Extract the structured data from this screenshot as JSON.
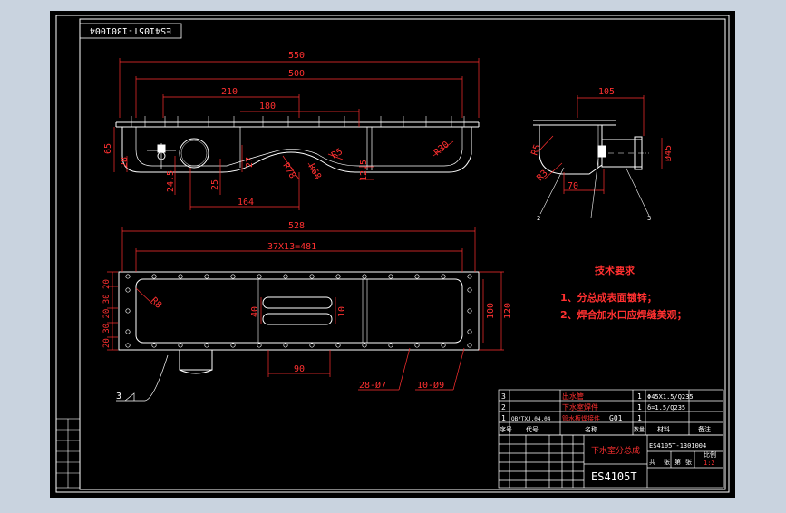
{
  "colors": {
    "viewer_bg": "#c9d3df",
    "sheet_bg": "#000000",
    "line": "#ffffff",
    "dim": "#ff3030",
    "title_text": "#ff3030",
    "table_line": "#ffffff",
    "hatch": "#ff3030"
  },
  "drawing_no_stamp": "ES4105T-1301004",
  "front_view": {
    "dims": {
      "overall_len": "550",
      "inner_len": "500",
      "d210": "210",
      "d180": "180",
      "d164": "164",
      "h65": "65",
      "h28": "28",
      "h245": "24.5",
      "h25": "25",
      "h27": "27",
      "h125": "12.5",
      "r78": "R78",
      "r68": "R68",
      "r5": "R5",
      "r30": "R30"
    }
  },
  "side_view": {
    "dims": {
      "d105": "105",
      "d70": "70",
      "r5": "R5",
      "r3": "R3",
      "dia45": "Ø45"
    },
    "balloons": [
      "2",
      "3"
    ]
  },
  "top_view": {
    "dims": {
      "overall_len": "528",
      "holes_pitch": "37X13=481",
      "h100": "100",
      "h120": "120",
      "d90": "90",
      "d40": "40",
      "d10": "10",
      "r8": "R8",
      "left_stack": "20 30 20 30 20",
      "holes_a": "28-Ø7",
      "holes_b": "10-Ø9",
      "weld_mark": "3"
    }
  },
  "notes": {
    "title": "技术要求",
    "items": [
      "1、分总成表面镀锌；",
      "2、焊合加水口应焊缝美观；"
    ]
  },
  "bom": {
    "rows": [
      {
        "no": "3",
        "code": "",
        "name": "出水管",
        "qty": "1",
        "material": "Φ45X1.5/Q235"
      },
      {
        "no": "2",
        "code": "",
        "name": "下水室焊件",
        "qty": "1",
        "material": "δ=1.5/Q235"
      },
      {
        "no": "1",
        "code": "QB/TXJ.04.04",
        "name": "管水板焊接件",
        "qty": "1",
        "material": "G01"
      }
    ],
    "header": [
      "序号",
      "代号",
      "名称",
      "数量",
      "材料",
      "备注"
    ]
  },
  "title_block": {
    "part_name": "下水室分总成",
    "drawing_no": "ES4105T-1301004",
    "model": "ES4105T",
    "scale_label": "比例",
    "scale": "1:2",
    "sheet_labels": [
      "共",
      "张",
      "第",
      "张"
    ]
  }
}
